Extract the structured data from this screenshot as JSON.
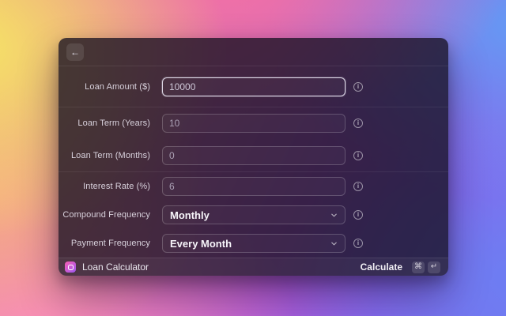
{
  "background": {
    "gradient_colors": [
      "#f6e267",
      "#f6ab85",
      "#f888c0",
      "#f06fa6",
      "#649af4",
      "#6d7df2",
      "#8e62ea"
    ]
  },
  "icons": {
    "back": "←",
    "info": "i",
    "chevron_down": "chevron-down",
    "app_icon": "loan-calculator-extension-icon"
  },
  "window": {
    "header": {
      "back_icon": "←"
    },
    "form": {
      "info_icon": "i",
      "sections": [
        {
          "rows": [
            {
              "label": "Loan Amount ($)",
              "value": "10000",
              "control": "text-input",
              "focused": true
            }
          ]
        },
        {
          "rows": [
            {
              "label": "Loan Term (Years)",
              "value": "10",
              "control": "text-input",
              "focused": false
            },
            {
              "label": "Loan Term (Months)",
              "value": "0",
              "control": "text-input",
              "focused": false
            }
          ]
        },
        {
          "rows": [
            {
              "label": "Interest Rate (%)",
              "value": "6",
              "control": "text-input",
              "focused": false
            },
            {
              "label": "Compound Frequency",
              "value": "Monthly",
              "control": "select",
              "focused": false
            },
            {
              "label": "Payment Frequency",
              "value": "Every Month",
              "control": "select",
              "focused": false
            }
          ]
        }
      ]
    },
    "footer": {
      "app_name": "Loan Calculator",
      "primary_action": "Calculate",
      "shortcut": {
        "cmd": "⌘",
        "enter": "↵"
      }
    }
  },
  "colors": {
    "window_tint": "rgba(22,15,32,0.78)",
    "focused_border": "#ece7f5",
    "app_icon_gradient": [
      "#f55fb0",
      "#9a58ef"
    ],
    "select_text": "#f7f5fa",
    "input_text": "#aba1b5",
    "label_text": "#d8d1dc"
  }
}
